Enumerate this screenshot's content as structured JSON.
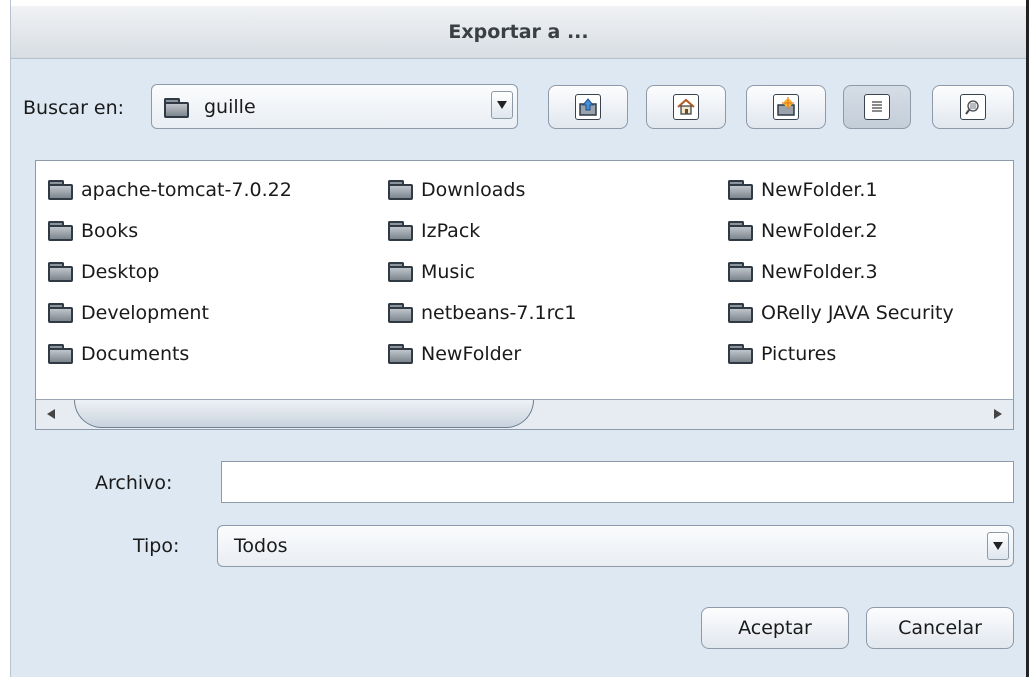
{
  "dialog": {
    "title": "Exportar a ..."
  },
  "toolbar": {
    "look_in_label": "Buscar en:",
    "look_in_value": "guille",
    "buttons": {
      "up": "up-folder-icon",
      "home": "home-icon",
      "new_folder": "new-folder-icon",
      "list_view": "list-view-icon",
      "details_view": "details-view-icon"
    }
  },
  "files": {
    "columns": [
      [
        "apache-tomcat-7.0.22",
        "Books",
        "Desktop",
        "Development",
        "Documents"
      ],
      [
        "Downloads",
        "IzPack",
        "Music",
        "netbeans-7.1rc1",
        "NewFolder"
      ],
      [
        "NewFolder.1",
        "NewFolder.2",
        "NewFolder.3",
        "ORelly JAVA Security",
        "Pictures"
      ]
    ]
  },
  "form": {
    "file_label": "Archivo:",
    "file_value": "",
    "type_label": "Tipo:",
    "type_value": "Todos"
  },
  "actions": {
    "accept": "Aceptar",
    "cancel": "Cancelar"
  },
  "colors": {
    "background": "#dde8f3",
    "list_bg": "#ffffff",
    "border": "#8c9aaa"
  }
}
